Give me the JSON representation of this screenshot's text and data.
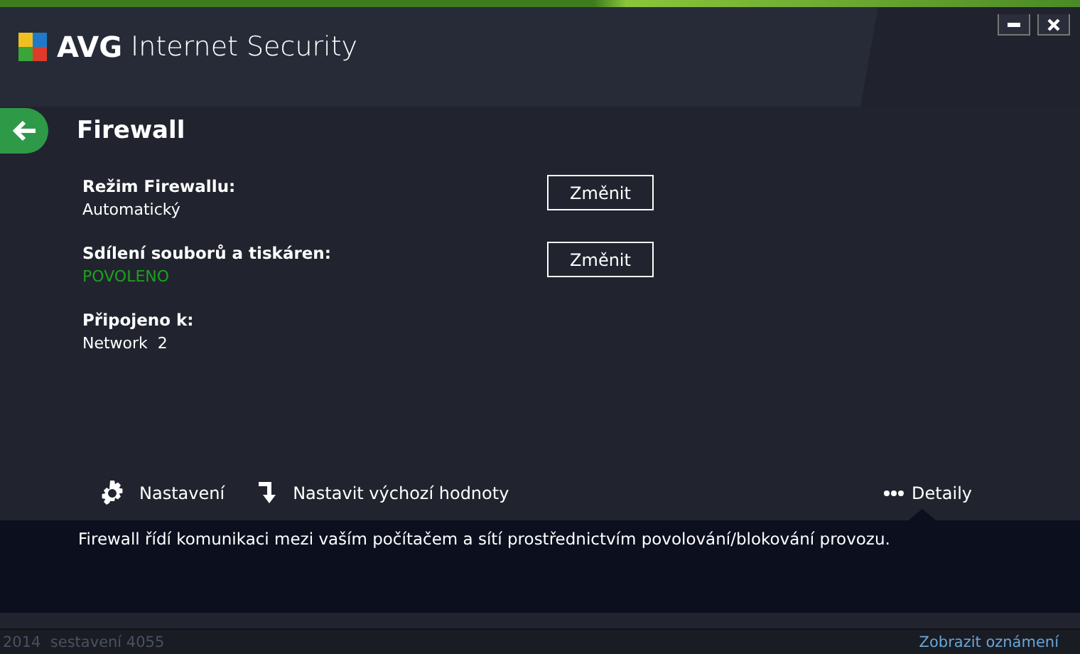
{
  "window": {
    "product": "AVG",
    "title": "Internet Security"
  },
  "page": {
    "title": "Firewall"
  },
  "items": [
    {
      "label": "Režim Firewallu:",
      "value": "Automatický",
      "kind": "plain",
      "button": "Změnit"
    },
    {
      "label": "Sdílení souborů a tiskáren:",
      "value": "POVOLENO",
      "kind": "status",
      "button": "Změnit"
    },
    {
      "label": "Připojeno k:",
      "value": "Network  2",
      "kind": "plain"
    }
  ],
  "actions": [
    {
      "label": "Nastavení",
      "kind": "settings"
    },
    {
      "label": "Nastavit výchozí hodnoty",
      "kind": "reset"
    }
  ],
  "details": {
    "label": "Detaily",
    "expanded": true,
    "text": "Firewall řídí komunikaci mezi vaším počítačem a sítí prostřednictvím povolování/blokování provozu."
  },
  "footer": {
    "build": "2014  sestavení 4055",
    "link": "Zobrazit oznámení"
  }
}
